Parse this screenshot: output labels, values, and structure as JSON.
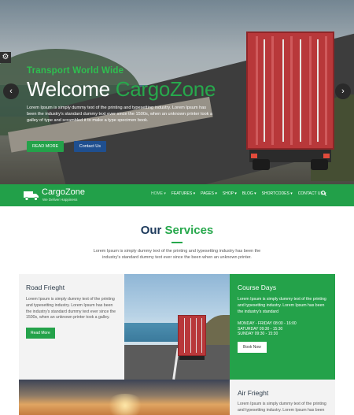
{
  "hero": {
    "subtitle": "Transport World Wide",
    "title_prefix": "Welcome",
    "title_brand": "CargoZone",
    "description": "Lorem Ipsum is simply dummy text of the printing and typesetting industry. Lorem Ipsum has been the industry's standard dummy text ever since the 1500s, when an unknown printer took a galley of type and scrambled it to make a type specimen book.",
    "primary_button": "READ MORE",
    "secondary_button": "Contact Us",
    "prev_arrow": "‹",
    "next_arrow": "›",
    "settings_icon": "gear-icon"
  },
  "nav": {
    "logo_name": "CargoZone",
    "logo_tagline": "We Deliver Happiness",
    "menu": [
      "HOME ▾",
      "FEATURES ▾",
      "PAGES ▾",
      "SHOP ▾",
      "BLOG ▾",
      "SHORTCODES ▾",
      "CONTACT US ▾"
    ],
    "search_icon": "search-icon"
  },
  "services": {
    "title_prefix": "Our",
    "title_accent": "Services",
    "description": "Lorem Ipsum is simply dummy text of the printing and typesetting industry has been the industry's standard dummy text ever since the been when an unknown printer."
  },
  "cards": {
    "road": {
      "title": "Road Frieght",
      "text": "Lorem Ipsum is simply dummy text of the printing and typesetting industry. Lorem Ipsum has been the industry's standard dummy text ever since the 1500s, when an unknown printer took a galley.",
      "button": "Read More"
    },
    "course": {
      "title": "Course Days",
      "text": "Lorem Ipsum is simply dummy text of the printing and typesetting industry. Lorem Ipsum has been the industry's standard",
      "hours": [
        "MONDAY - FRIDAY 08:00 - 16:00",
        "SATURDAY 09:30 - 15:30",
        "SUNDAY 09:30 - 15:30"
      ],
      "button": "Book Now"
    },
    "air": {
      "title": "Air Frieght",
      "text": "Lorem Ipsum is simply dummy text of the printing and typesetting industry. Lorem Ipsum has been"
    }
  },
  "colors": {
    "brand_green": "#24a24a",
    "navy": "#1d3a5c",
    "button_blue": "#1f4f8f"
  }
}
